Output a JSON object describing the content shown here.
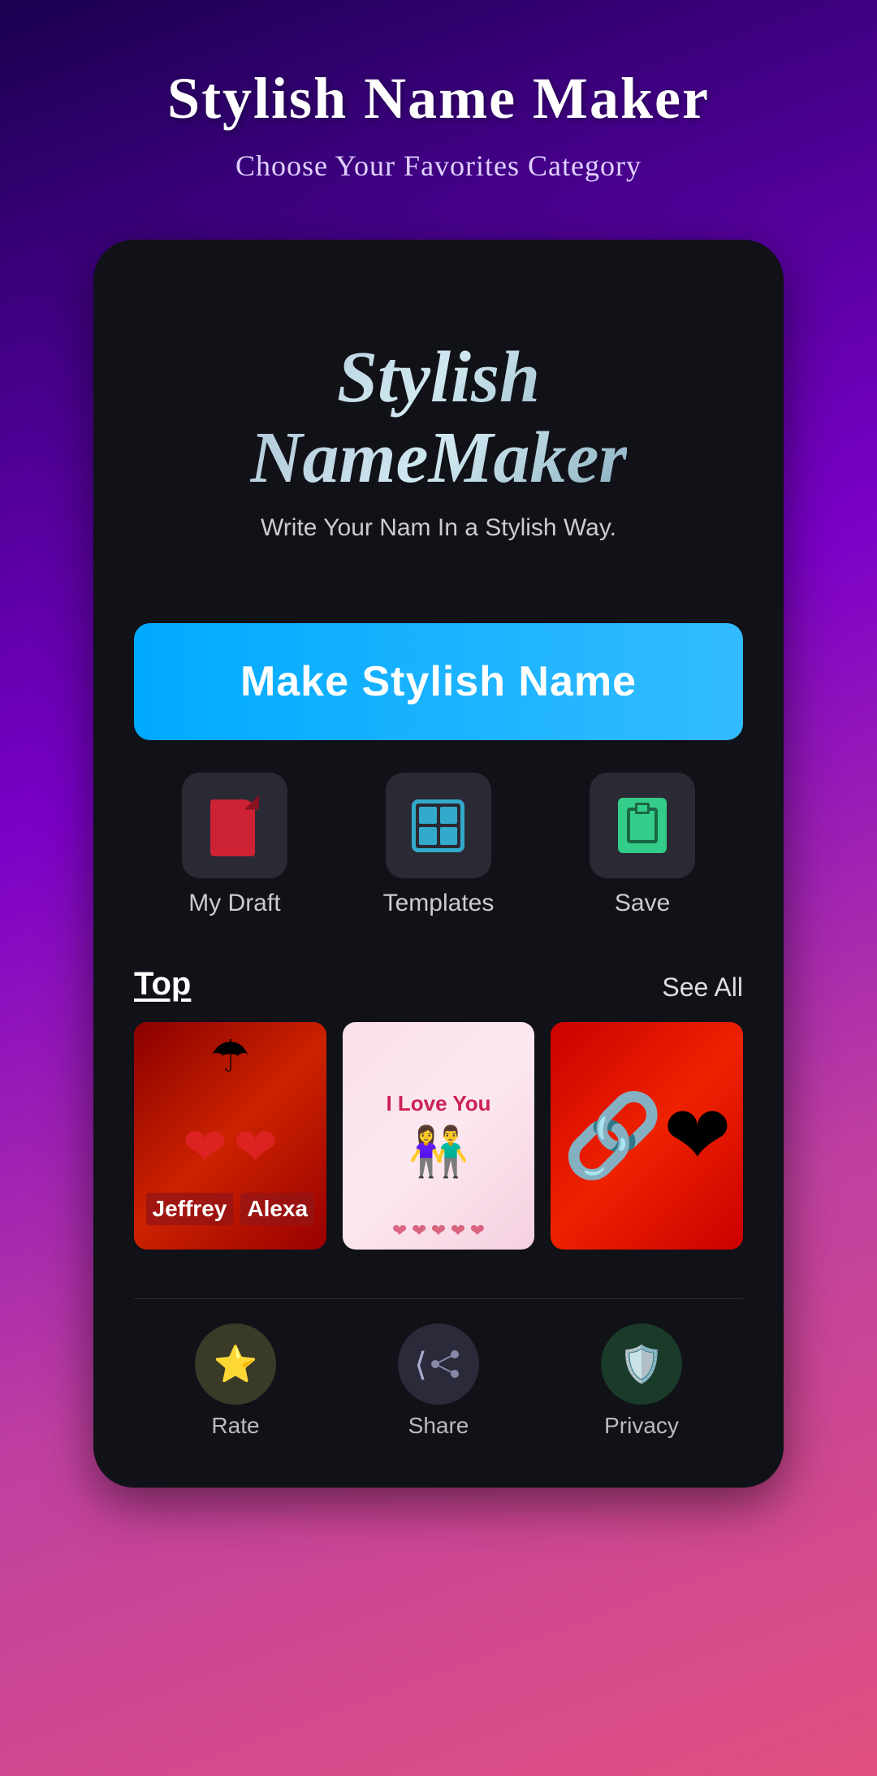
{
  "header": {
    "title": "Stylish Name Maker",
    "subtitle": "Choose Your Favorites Category"
  },
  "logo": {
    "line1": "Stylish",
    "line2": "NameMaker",
    "tagline": "Write Your Nam In a Stylish Way."
  },
  "main_button": {
    "label": "Make Stylish Name"
  },
  "action_buttons": [
    {
      "id": "draft",
      "label": "My Draft",
      "icon": "draft-icon"
    },
    {
      "id": "templates",
      "label": "Templates",
      "icon": "templates-icon"
    },
    {
      "id": "save",
      "label": "Save",
      "icon": "save-icon"
    }
  ],
  "top_section": {
    "label": "Top",
    "see_all": "See All"
  },
  "top_cards": [
    {
      "id": "jeffrey-alexa",
      "name1": "Jeffrey",
      "name2": "Alexa",
      "type": "hearts"
    },
    {
      "id": "love-you",
      "title": "I Love You",
      "type": "couple"
    },
    {
      "id": "locket",
      "type": "locket"
    }
  ],
  "bottom_nav": [
    {
      "id": "rate",
      "label": "Rate",
      "icon": "⭐",
      "bg": "nav-rate"
    },
    {
      "id": "share",
      "label": "Share",
      "icon": "↗",
      "bg": "nav-share"
    },
    {
      "id": "privacy",
      "label": "Privacy",
      "icon": "🛡",
      "bg": "nav-privacy"
    }
  ],
  "colors": {
    "accent_blue": "#33aaff",
    "bg_dark": "#111118",
    "gradient_start": "#1a0050",
    "gradient_end": "#e05080"
  }
}
